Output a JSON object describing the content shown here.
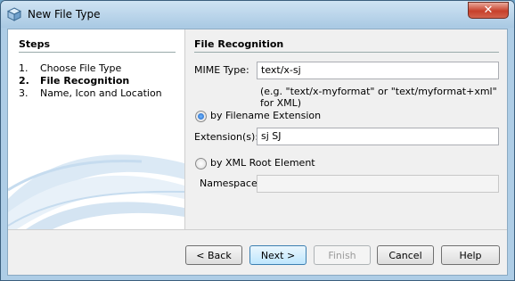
{
  "window": {
    "title": "New File Type",
    "close_label": "✕"
  },
  "steps": {
    "heading": "Steps",
    "items": [
      {
        "num": "1.",
        "label": "Choose File Type"
      },
      {
        "num": "2.",
        "label": "File Recognition"
      },
      {
        "num": "3.",
        "label": "Name, Icon and Location"
      }
    ]
  },
  "form": {
    "heading": "File Recognition",
    "mime_label": "MIME Type:",
    "mime_value": "text/x-sj",
    "mime_hint": "(e.g. \"text/x-myformat\" or \"text/myformat+xml\" for XML)",
    "radio_ext_label": "by Filename Extension",
    "ext_label": "Extension(s):",
    "ext_value": "sj SJ",
    "radio_xml_label": "by XML Root Element",
    "ns_label": "Namespace:",
    "ns_value": ""
  },
  "buttons": {
    "back": "< Back",
    "next": "Next >",
    "finish": "Finish",
    "cancel": "Cancel",
    "help": "Help"
  }
}
